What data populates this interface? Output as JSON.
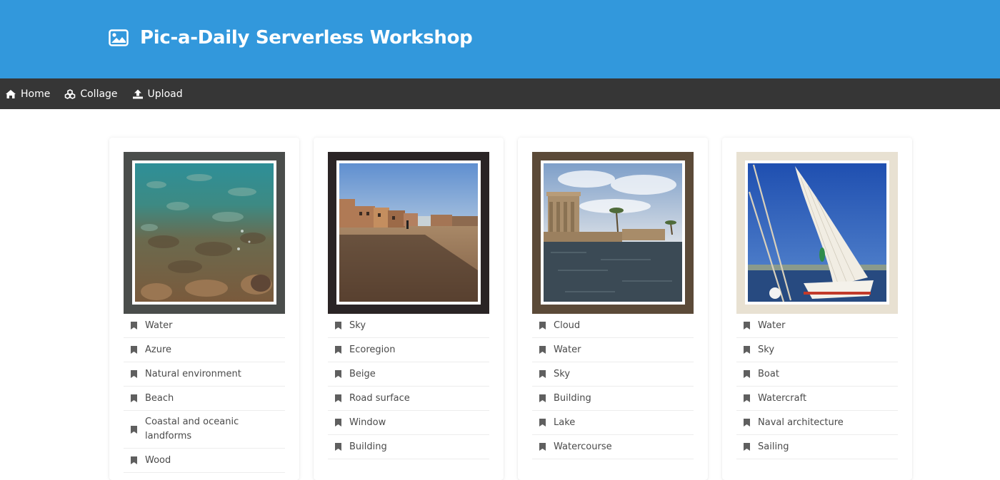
{
  "header": {
    "title": "Pic-a-Daily Serverless Workshop",
    "icon": "image-icon",
    "color": "#3298dc"
  },
  "nav": {
    "items": [
      {
        "label": "Home",
        "icon": "home-icon"
      },
      {
        "label": "Collage",
        "icon": "cubes-icon"
      },
      {
        "label": "Upload",
        "icon": "upload-icon"
      }
    ]
  },
  "cards": [
    {
      "frame_color": "#4a4d4b",
      "labels": [
        "Water",
        "Azure",
        "Natural environment",
        "Beach",
        "Coastal and oceanic landforms",
        "Wood"
      ]
    },
    {
      "frame_color": "#2a2425",
      "labels": [
        "Sky",
        "Ecoregion",
        "Beige",
        "Road surface",
        "Window",
        "Building"
      ]
    },
    {
      "frame_color": "#5b4a38",
      "labels": [
        "Cloud",
        "Water",
        "Sky",
        "Building",
        "Lake",
        "Watercourse"
      ]
    },
    {
      "frame_color": "#e8e1d2",
      "labels": [
        "Water",
        "Sky",
        "Boat",
        "Watercraft",
        "Naval architecture",
        "Sailing"
      ]
    }
  ]
}
